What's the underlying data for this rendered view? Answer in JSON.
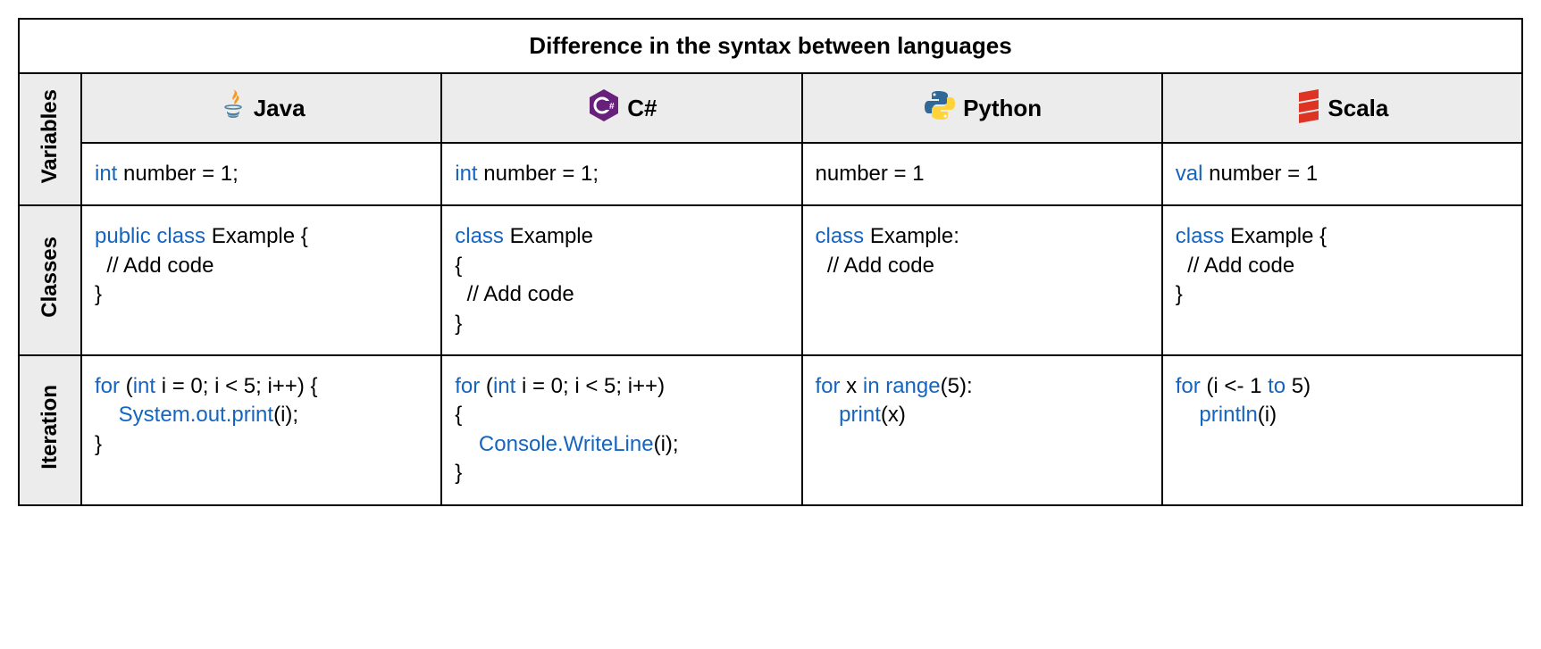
{
  "title": "Difference in the syntax between languages",
  "rowHeaders": {
    "variables": "Variables",
    "classes": "Classes",
    "iteration": "Iteration"
  },
  "languages": {
    "java": "Java",
    "csharp": "C#",
    "python": "Python",
    "scala": "Scala"
  },
  "cells": {
    "variables": {
      "java": [
        {
          "t": "int",
          "c": "kw"
        },
        {
          "t": " number = 1;",
          "c": "txt"
        }
      ],
      "csharp": [
        {
          "t": "int",
          "c": "kw"
        },
        {
          "t": " number = 1;",
          "c": "txt"
        }
      ],
      "python": [
        {
          "t": "number = 1",
          "c": "txt"
        }
      ],
      "scala": [
        {
          "t": "val",
          "c": "kw"
        },
        {
          "t": " number = 1",
          "c": "txt"
        }
      ]
    },
    "classes": {
      "java": [
        {
          "t": "public class",
          "c": "kw"
        },
        {
          "t": " Example {\n  // Add code\n}",
          "c": "txt"
        }
      ],
      "csharp": [
        {
          "t": "class",
          "c": "kw"
        },
        {
          "t": " Example\n{\n  // Add code\n}",
          "c": "txt"
        }
      ],
      "python": [
        {
          "t": "class",
          "c": "kw"
        },
        {
          "t": " Example:\n  // Add code",
          "c": "txt"
        }
      ],
      "scala": [
        {
          "t": "class",
          "c": "kw"
        },
        {
          "t": " Example {\n  // Add code\n}",
          "c": "txt"
        }
      ]
    },
    "iteration": {
      "java": [
        {
          "t": "for",
          "c": "kw"
        },
        {
          "t": " (",
          "c": "txt"
        },
        {
          "t": "int",
          "c": "kw"
        },
        {
          "t": " i = 0; i < 5; i++) {\n    ",
          "c": "txt"
        },
        {
          "t": "System.out.print",
          "c": "kw"
        },
        {
          "t": "(i);\n}",
          "c": "txt"
        }
      ],
      "csharp": [
        {
          "t": "for",
          "c": "kw"
        },
        {
          "t": " (",
          "c": "txt"
        },
        {
          "t": "int",
          "c": "kw"
        },
        {
          "t": " i = 0; i < 5; i++)\n{\n    ",
          "c": "txt"
        },
        {
          "t": "Console.WriteLine",
          "c": "kw"
        },
        {
          "t": "(i);\n}",
          "c": "txt"
        }
      ],
      "python": [
        {
          "t": "for",
          "c": "kw"
        },
        {
          "t": " x ",
          "c": "txt"
        },
        {
          "t": "in",
          "c": "kw"
        },
        {
          "t": " ",
          "c": "txt"
        },
        {
          "t": "range",
          "c": "kw"
        },
        {
          "t": "(5):\n    ",
          "c": "txt"
        },
        {
          "t": "print",
          "c": "kw"
        },
        {
          "t": "(x)",
          "c": "txt"
        }
      ],
      "scala": [
        {
          "t": "for",
          "c": "kw"
        },
        {
          "t": " (i <- 1 ",
          "c": "txt"
        },
        {
          "t": "to",
          "c": "kw"
        },
        {
          "t": " 5)\n    ",
          "c": "txt"
        },
        {
          "t": "println",
          "c": "kw"
        },
        {
          "t": "(i)",
          "c": "txt"
        }
      ]
    }
  }
}
